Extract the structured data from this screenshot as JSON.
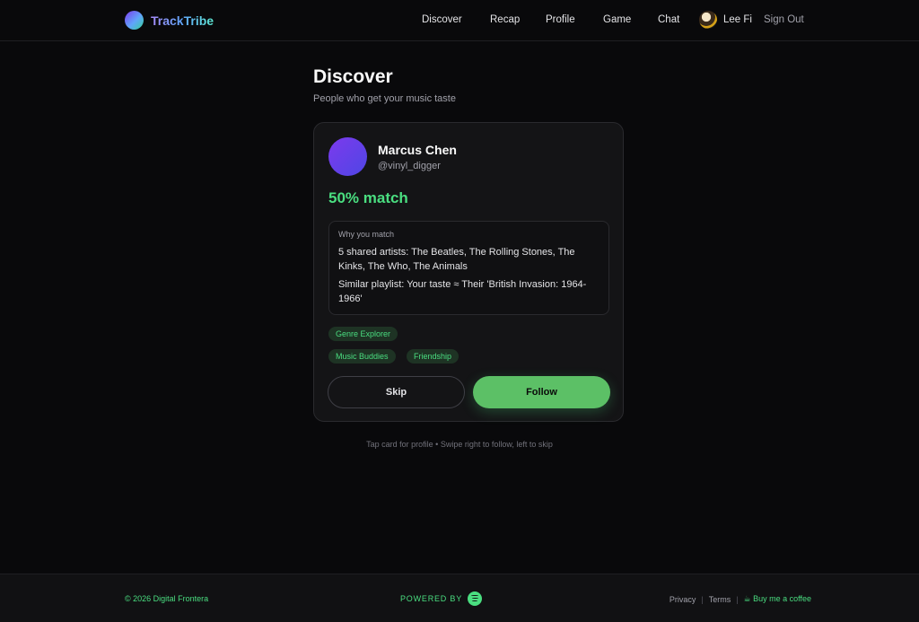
{
  "nav": {
    "brand": "TrackTribe",
    "links": [
      "Discover",
      "Recap",
      "Profile",
      "Game",
      "Chat"
    ],
    "user_name": "Lee Fi",
    "sign_out": "Sign Out"
  },
  "header": {
    "title": "Discover",
    "subtitle": "People who get your music taste"
  },
  "card": {
    "name": "Marcus Chen",
    "handle": "@vinyl_digger",
    "match": "50% match",
    "reasons_title": "Why you match",
    "reasons": [
      "5 shared artists: The Beatles, The Rolling Stones, The Kinks, The Who, The Animals",
      "Similar playlist: Your taste ≈ Their 'British Invasion: 1964-1966'"
    ],
    "tags": [
      "Genre Explorer",
      "Music Buddies",
      "Friendship"
    ],
    "skip_label": "Skip",
    "follow_label": "Follow"
  },
  "hint": "Tap card for profile • Swipe right to follow, left to skip",
  "footer": {
    "copyright": "© 2026 Digital Frontera",
    "powered_by": "POWERED BY",
    "links": [
      "Privacy",
      "Terms"
    ],
    "coffee": "☕ Buy me a coffee"
  },
  "colors": {
    "accent": "#4ade80",
    "follow_button": "#5cc066",
    "background": "#09090b",
    "card": "#141416"
  }
}
